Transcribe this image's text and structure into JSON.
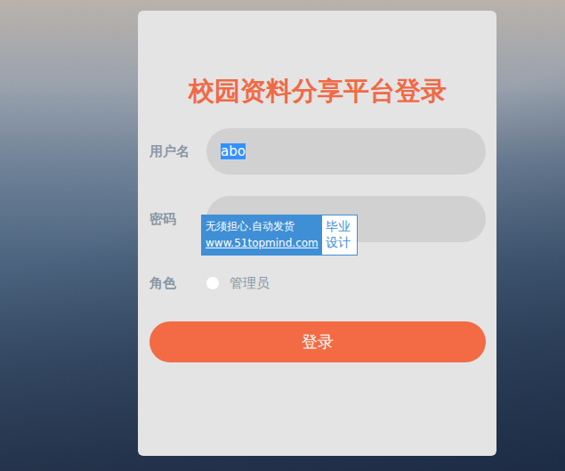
{
  "title": "校园资料分享平台登录",
  "fields": [
    {
      "label": "用户名",
      "value": "abo",
      "selected": true
    },
    {
      "label": "密码",
      "value": "",
      "selected": false
    }
  ],
  "role": {
    "label": "角色",
    "options": [
      {
        "label": "管理员",
        "selected": false
      }
    ]
  },
  "login_button": "登录",
  "watermark": {
    "line1": "无须担心.自动发货",
    "line2": "www.51topmind.com",
    "badge": "毕业设计"
  }
}
